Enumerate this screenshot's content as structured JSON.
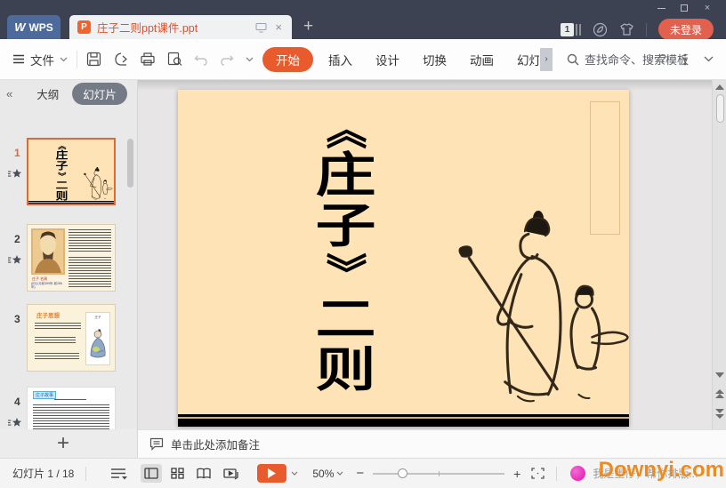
{
  "titlebar": {
    "wps_label": "WPS",
    "wps_logo_glyph": "W",
    "tab_title": "庄子二则ppt课件.ppt",
    "ppt_icon_glyph": "P",
    "tab_close_glyph": "×",
    "new_tab_glyph": "+",
    "doc_badge": "1",
    "login_label": "未登录",
    "close_glyph": "×"
  },
  "ribbon": {
    "file_label": "文件",
    "tabs": [
      "开始",
      "插入",
      "设计",
      "切换",
      "动画",
      "幻灯片"
    ],
    "active_tab": "开始",
    "overflow_glyph": "›",
    "search_label": "查找命令、搜索模板",
    "help_glyph": "?"
  },
  "sidebar": {
    "collapse_glyph": "«",
    "outline_tab_label": "大纲",
    "slides_tab_label": "幻灯片",
    "add_slide_glyph": "+",
    "slides": [
      {
        "num": "1"
      },
      {
        "num": "2",
        "caption1": "庄子 名周",
        "caption2": "(约公元前369年-前286年)"
      },
      {
        "num": "3",
        "title": "庄子思想",
        "image_caption": "庄子"
      },
      {
        "num": "4",
        "title": "庄子故事"
      }
    ]
  },
  "slide": {
    "full_title": "《庄子》二则",
    "chars": [
      "《",
      "庄",
      "子",
      "》",
      "二",
      "则"
    ]
  },
  "notes": {
    "placeholder": "单击此处添加备注"
  },
  "statusbar": {
    "slide_counter": "幻灯片 1 / 18",
    "zoom_value": "50%",
    "zoom_out_glyph": "−",
    "zoom_in_glyph": "+",
    "assistant_text": "我是墨仔，帮你排版...",
    "watermark": "Downyi.com"
  },
  "colors": {
    "accent_orange": "#e95b2c",
    "slide_beige": "#fde3b5",
    "titlebar_dark": "#3d4252",
    "selected_border": "#dd6a35",
    "watermark_orange": "#ef8a1d",
    "login_red": "#e2604e"
  }
}
